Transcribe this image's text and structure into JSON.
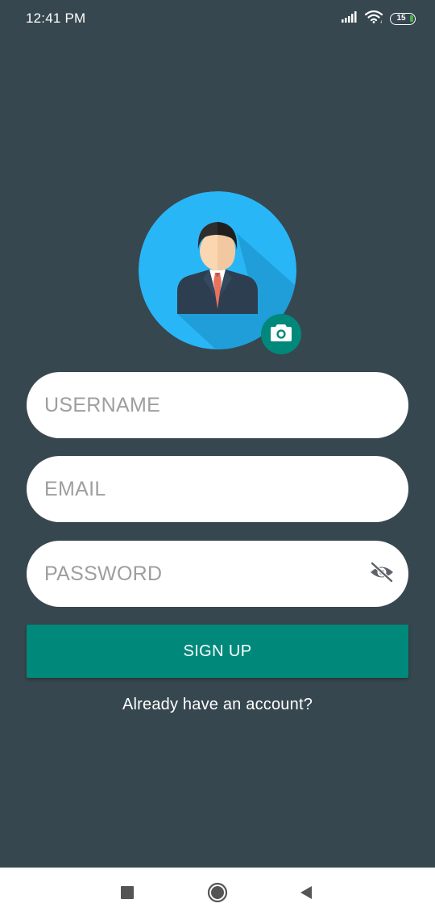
{
  "status_bar": {
    "time": "12:41 PM",
    "battery_level": "15",
    "icons": [
      "signal-icon",
      "wifi-icon",
      "battery-icon"
    ]
  },
  "avatar": {
    "icon": "user-avatar-icon",
    "camera_icon": "camera-icon"
  },
  "form": {
    "username": {
      "placeholder": "USERNAME",
      "value": ""
    },
    "email": {
      "placeholder": "EMAIL",
      "value": ""
    },
    "password": {
      "placeholder": "PASSWORD",
      "value": "",
      "toggle_icon": "eye-off-icon"
    },
    "submit_label": "SIGN UP",
    "login_link": "Already have an account?"
  },
  "nav_bar": {
    "icons": [
      "recents-icon",
      "home-icon",
      "back-icon"
    ]
  },
  "colors": {
    "background": "#37474f",
    "accent": "#00897b",
    "avatar_circle": "#29b6f6",
    "field_bg": "#ffffff",
    "placeholder": "#9e9e9e"
  }
}
